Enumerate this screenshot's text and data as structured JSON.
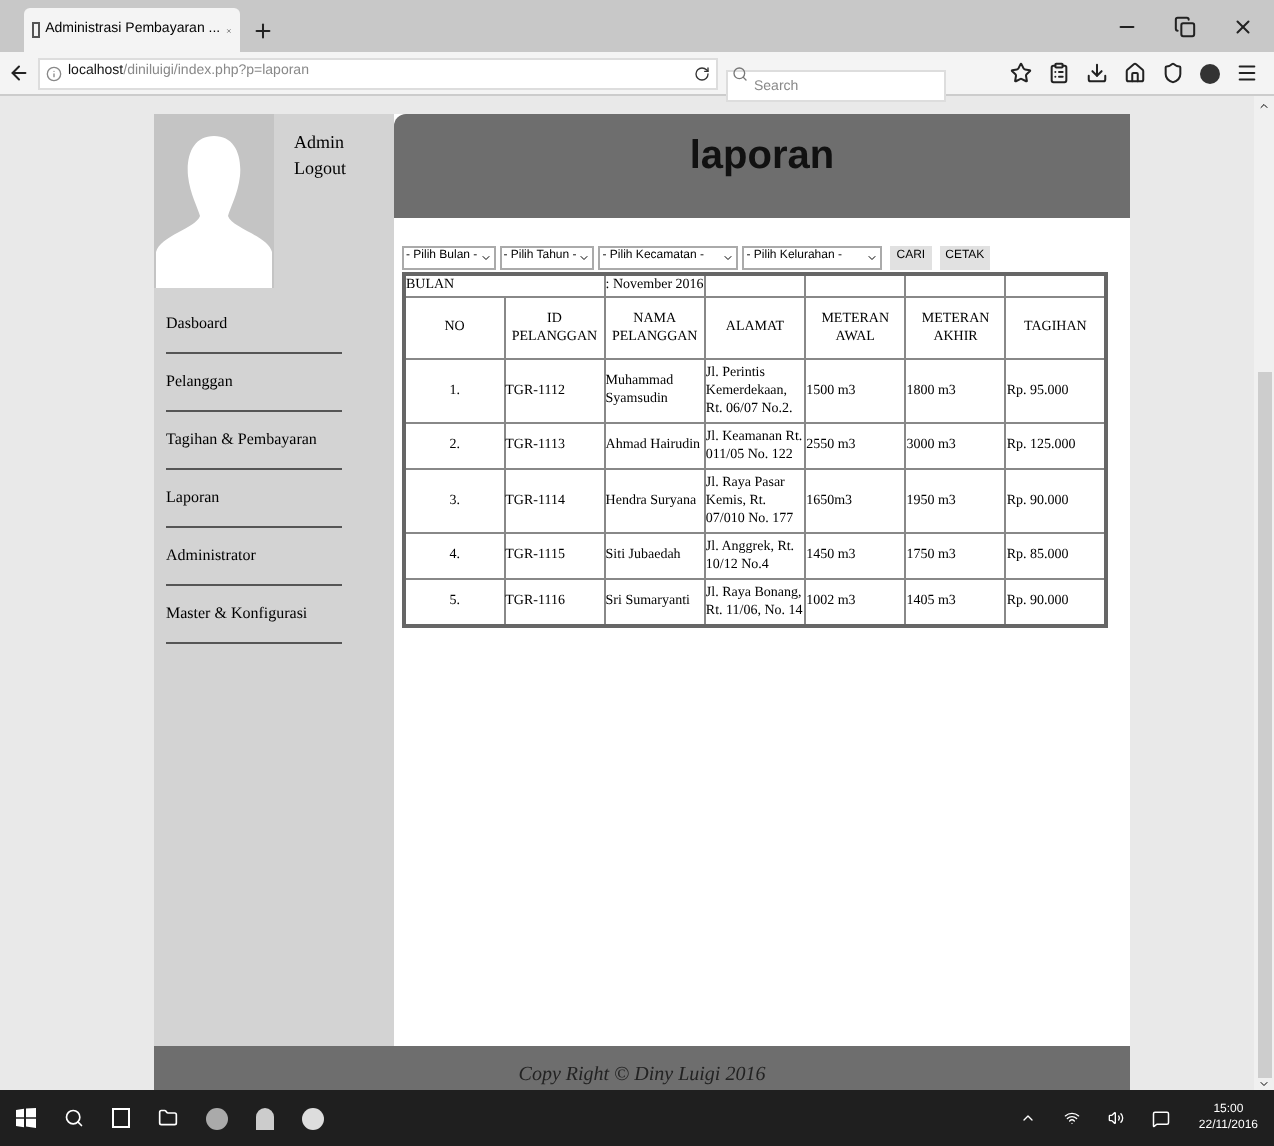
{
  "browser": {
    "tab_title": "Administrasi Pembayaran ...",
    "address_host": "localhost",
    "address_path": "/diniluigi/index.php?p=laporan",
    "search_placeholder": "Search"
  },
  "user": {
    "name": "Admin",
    "link": "Logout"
  },
  "menu": [
    "Dasboard",
    "Pelanggan",
    "Tagihan & Pembayaran",
    "Laporan",
    "Administrator",
    "Master & Konfigurasi"
  ],
  "page_title": "laporan",
  "filters": {
    "selects": [
      "- Pilih Bulan -",
      "- Pilih Tahun -",
      "- Pilih Kecamatan -",
      "- Pilih Kelurahan -"
    ],
    "buttons": [
      "CARI",
      "CETAK"
    ]
  },
  "table": {
    "period_label": "BULAN",
    "period_value": ": November 2016",
    "columns": [
      "NO",
      "ID PELANGGAN",
      "NAMA PELANGGAN",
      "ALAMAT",
      "METERAN AWAL",
      "METERAN AKHIR",
      "TAGIHAN"
    ],
    "rows": [
      [
        "1.",
        "TGR-1112",
        "Muhammad Syamsudin",
        "Jl. Perintis Kemerdekaan, Rt. 06/07 No.2.",
        "1500 m3",
        "1800 m3",
        "Rp. 95.000"
      ],
      [
        "2.",
        "TGR-1113",
        "Ahmad Hairudin",
        "Jl. Keamanan Rt. 011/05 No. 122",
        "2550 m3",
        "3000 m3",
        "Rp. 125.000"
      ],
      [
        "3.",
        "TGR-1114",
        "Hendra Suryana",
        "Jl. Raya Pasar Kemis, Rt. 07/010 No. 177",
        "1650m3",
        "1950 m3",
        "Rp. 90.000"
      ],
      [
        "4.",
        "TGR-1115",
        "Siti Jubaedah",
        "Jl. Anggrek, Rt. 10/12 No.4",
        "1450 m3",
        "1750 m3",
        "Rp. 85.000"
      ],
      [
        "5.",
        "TGR-1116",
        "Sri Sumaryanti",
        "Jl. Raya Bonang, Rt. 11/06, No. 14",
        "1002 m3",
        "1405 m3",
        "Rp. 90.000"
      ]
    ]
  },
  "footer": "Copy Right © Diny Luigi 2016",
  "taskbar": {
    "time": "15:00",
    "date": "22/11/2016"
  }
}
